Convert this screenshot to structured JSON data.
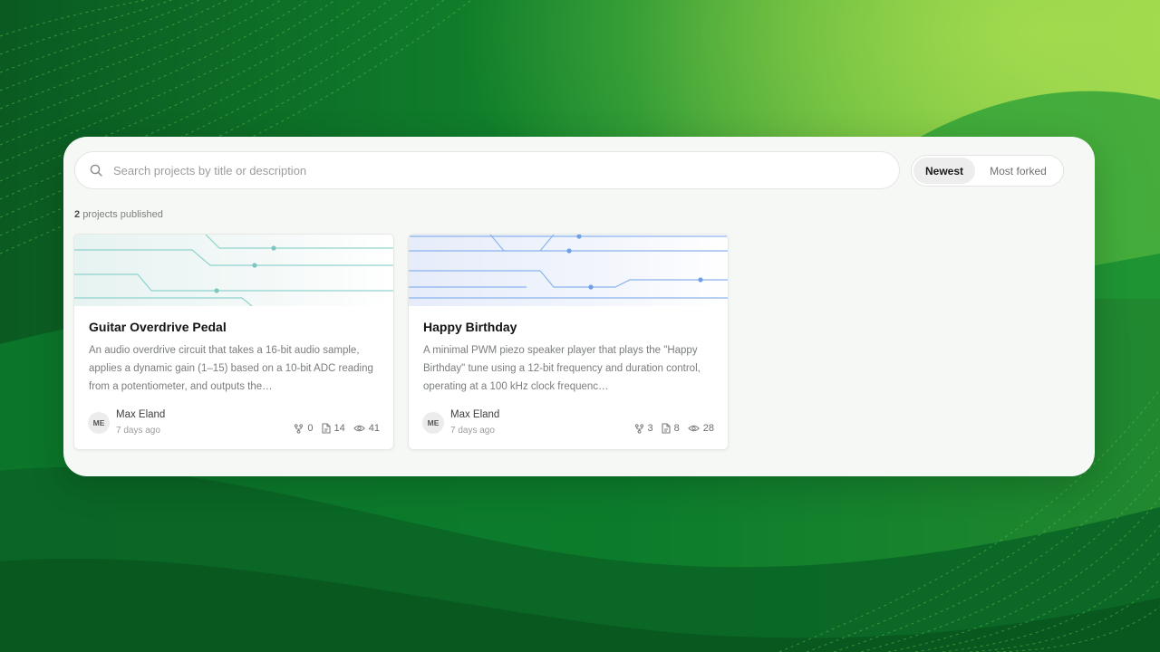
{
  "search": {
    "placeholder": "Search projects by title or description"
  },
  "sort": {
    "options": [
      "Newest",
      "Most forked"
    ],
    "selected": "Newest"
  },
  "summary": {
    "count": "2",
    "label": "projects published"
  },
  "projects": [
    {
      "title": "Guitar Overdrive Pedal",
      "description": "An audio overdrive circuit that takes a 16-bit audio sample, applies a dynamic gain (1–15) based on a 10-bit ADC reading from a potentiometer, and outputs the…",
      "author_initials": "ME",
      "author": "Max Eland",
      "time": "7 days ago",
      "forks": "0",
      "files": "14",
      "views": "41"
    },
    {
      "title": "Happy Birthday",
      "description": "A minimal PWM piezo speaker player that plays the \"Happy Birthday\" tune using a 12-bit frequency and duration control, operating at a 100 kHz clock frequenc…",
      "author_initials": "ME",
      "author": "Max Eland",
      "time": "7 days ago",
      "forks": "3",
      "files": "8",
      "views": "28"
    }
  ],
  "colors": {
    "accent_green": "#0b6a2a",
    "teal_trace": "#8fd3cd",
    "blue_trace": "#8ab4ec"
  }
}
